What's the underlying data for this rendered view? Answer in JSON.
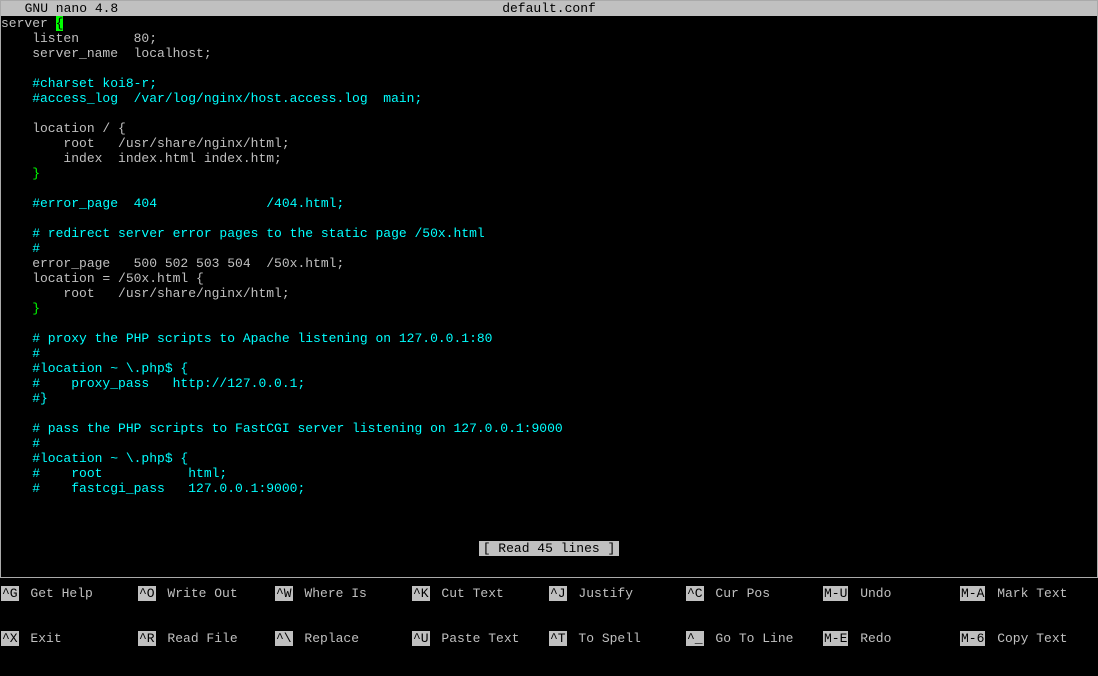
{
  "titlebar": {
    "app": "  GNU nano 4.8",
    "filename": "default.conf"
  },
  "lines": [
    {
      "type": "first",
      "prefix": "server ",
      "brace": "{"
    },
    {
      "text": "    listen       80;",
      "cls": "plain"
    },
    {
      "text": "    server_name  localhost;",
      "cls": "plain"
    },
    {
      "text": "",
      "cls": "plain"
    },
    {
      "text": "    #charset koi8-r;",
      "cls": "cyan"
    },
    {
      "text": "    #access_log  /var/log/nginx/host.access.log  main;",
      "cls": "cyan"
    },
    {
      "text": "",
      "cls": "plain"
    },
    {
      "text": "    location / {",
      "cls": "plain"
    },
    {
      "text": "        root   /usr/share/nginx/html;",
      "cls": "plain"
    },
    {
      "text": "        index  index.html index.htm;",
      "cls": "plain"
    },
    {
      "text": "    }",
      "cls": "green"
    },
    {
      "text": "",
      "cls": "plain"
    },
    {
      "text": "    #error_page  404              /404.html;",
      "cls": "cyan"
    },
    {
      "text": "",
      "cls": "plain"
    },
    {
      "text": "    # redirect server error pages to the static page /50x.html",
      "cls": "cyan"
    },
    {
      "text": "    #",
      "cls": "cyan"
    },
    {
      "text": "    error_page   500 502 503 504  /50x.html;",
      "cls": "plain"
    },
    {
      "text": "    location = /50x.html {",
      "cls": "plain"
    },
    {
      "text": "        root   /usr/share/nginx/html;",
      "cls": "plain"
    },
    {
      "text": "    }",
      "cls": "green"
    },
    {
      "text": "",
      "cls": "plain"
    },
    {
      "text": "    # proxy the PHP scripts to Apache listening on 127.0.0.1:80",
      "cls": "cyan"
    },
    {
      "text": "    #",
      "cls": "cyan"
    },
    {
      "text": "    #location ~ \\.php$ {",
      "cls": "cyan"
    },
    {
      "text": "    #    proxy_pass   http://127.0.0.1;",
      "cls": "cyan"
    },
    {
      "text": "    #}",
      "cls": "cyan"
    },
    {
      "text": "",
      "cls": "plain"
    },
    {
      "text": "    # pass the PHP scripts to FastCGI server listening on 127.0.0.1:9000",
      "cls": "cyan"
    },
    {
      "text": "    #",
      "cls": "cyan"
    },
    {
      "text": "    #location ~ \\.php$ {",
      "cls": "cyan"
    },
    {
      "text": "    #    root           html;",
      "cls": "cyan"
    },
    {
      "text": "    #    fastcgi_pass   127.0.0.1:9000;",
      "cls": "cyan"
    }
  ],
  "status": "[ Read 45 lines ]",
  "shortcuts": {
    "row1": [
      {
        "key": "^G",
        "label": "Get Help"
      },
      {
        "key": "^O",
        "label": "Write Out"
      },
      {
        "key": "^W",
        "label": "Where Is"
      },
      {
        "key": "^K",
        "label": "Cut Text"
      },
      {
        "key": "^J",
        "label": "Justify"
      },
      {
        "key": "^C",
        "label": "Cur Pos"
      },
      {
        "key": "M-U",
        "label": "Undo"
      },
      {
        "key": "M-A",
        "label": "Mark Text"
      }
    ],
    "row2": [
      {
        "key": "^X",
        "label": "Exit"
      },
      {
        "key": "^R",
        "label": "Read File"
      },
      {
        "key": "^\\",
        "label": "Replace"
      },
      {
        "key": "^U",
        "label": "Paste Text"
      },
      {
        "key": "^T",
        "label": "To Spell"
      },
      {
        "key": "^_",
        "label": "Go To Line"
      },
      {
        "key": "M-E",
        "label": "Redo"
      },
      {
        "key": "M-6",
        "label": "Copy Text"
      }
    ]
  }
}
